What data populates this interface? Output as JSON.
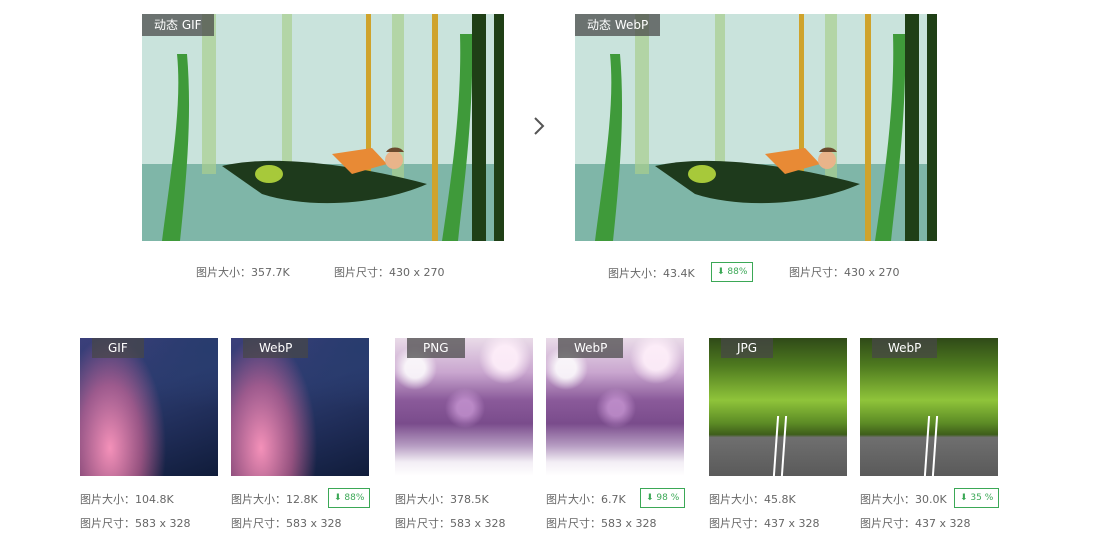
{
  "top": {
    "left": {
      "tag": "动态 GIF",
      "size_label": "图片大小：357.7K",
      "dim_label": "图片尺寸：430 x 270"
    },
    "right": {
      "tag": "动态 WebP",
      "size_label": "图片大小：43.4K",
      "savings": "88%",
      "dim_label": "图片尺寸：430 x 270"
    }
  },
  "cards": [
    {
      "tag": "GIF",
      "size_label": "图片大小：104.8K",
      "dim_label": "图片尺寸：583 x 328"
    },
    {
      "tag": "WebP",
      "size_label": "图片大小：12.8K",
      "savings": "88%",
      "dim_label": "图片尺寸：583 x 328"
    },
    {
      "tag": "PNG",
      "size_label": "图片大小：378.5K",
      "dim_label": "图片尺寸：583 x 328"
    },
    {
      "tag": "WebP",
      "size_label": "图片大小：6.7K",
      "savings": "98 %",
      "dim_label": "图片尺寸：583 x 328"
    },
    {
      "tag": "JPG",
      "size_label": "图片大小：45.8K",
      "dim_label": "图片尺寸：437 x 328"
    },
    {
      "tag": "WebP",
      "size_label": "图片大小：30.0K",
      "savings": "35 %",
      "dim_label": "图片尺寸：437 x 328"
    }
  ],
  "colors": {
    "savings_green": "#3ba856",
    "tag_bg": "#464646"
  },
  "icons": {
    "arrow": "chevron-right-icon",
    "savings": "down-arrow-icon"
  }
}
